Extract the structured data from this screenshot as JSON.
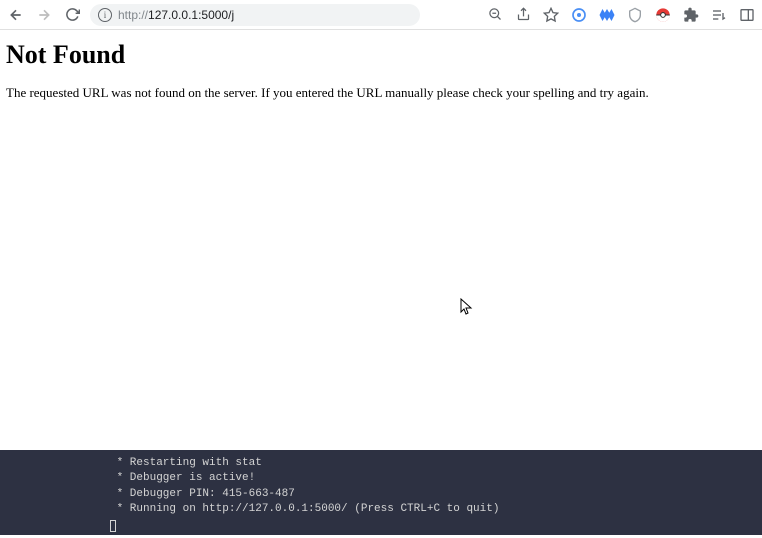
{
  "toolbar": {
    "url_protocol": "http://",
    "url_rest": "127.0.0.1:5000/j"
  },
  "page": {
    "heading": "Not Found",
    "message": "The requested URL was not found on the server. If you entered the URL manually please check your spelling and try again."
  },
  "terminal": {
    "lines": [
      " * Restarting with stat",
      " * Debugger is active!",
      " * Debugger PIN: 415-663-487",
      " * Running on http://127.0.0.1:5000/ (Press CTRL+C to quit)"
    ]
  }
}
